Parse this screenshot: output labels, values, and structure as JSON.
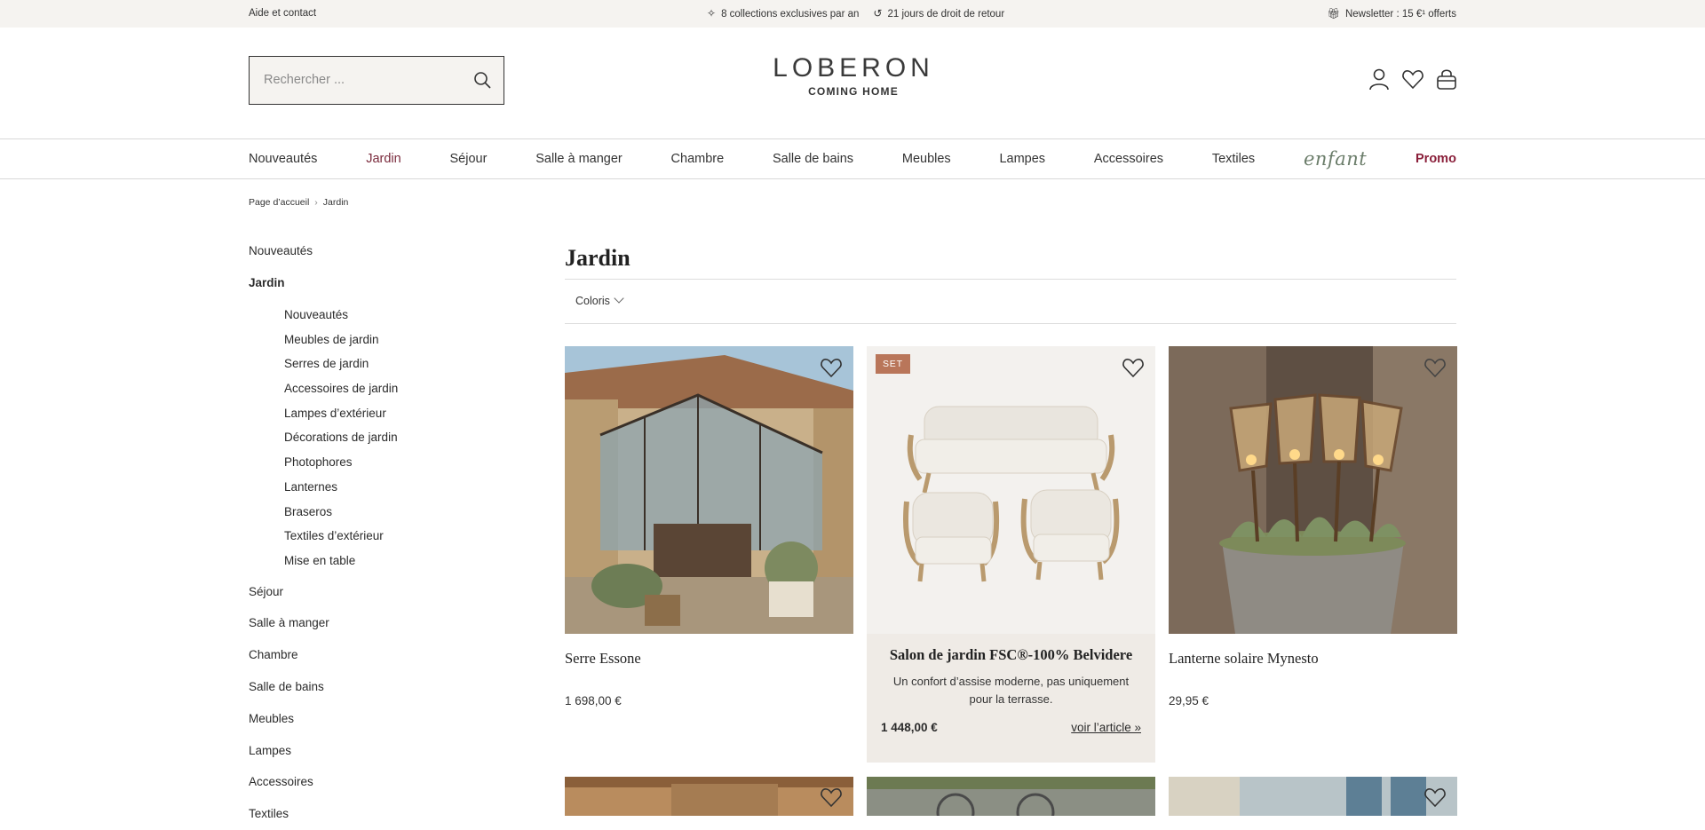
{
  "topbar": {
    "help": "Aide et contact",
    "usp1": "8 collections exclusives par an",
    "usp2": "21 jours de droit de retour",
    "newsletter": "Newsletter : 15 €¹ offerts"
  },
  "header": {
    "search_placeholder": "Rechercher ...",
    "logo_name": "LOBERON",
    "logo_tag": "COMING HOME"
  },
  "nav": {
    "items": [
      "Nouveautés",
      "Jardin",
      "Séjour",
      "Salle à manger",
      "Chambre",
      "Salle de bains",
      "Meubles",
      "Lampes",
      "Accessoires",
      "Textiles",
      "enfant",
      "Promo"
    ]
  },
  "breadcrumb": {
    "home": "Page d’accueil",
    "current": "Jardin"
  },
  "sidebar": {
    "top": "Nouveautés",
    "active": "Jardin",
    "sub": [
      "Nouveautés",
      "Meubles de jardin",
      "Serres de jardin",
      "Accessoires de jardin",
      "Lampes d’extérieur",
      "Décorations de jardin",
      "Photophores",
      "Lanternes",
      "Braseros",
      "Textiles d’extérieur",
      "Mise en table"
    ],
    "rest": [
      "Séjour",
      "Salle à manger",
      "Chambre",
      "Salle de bains",
      "Meubles",
      "Lampes",
      "Accessoires",
      "Textiles"
    ]
  },
  "main": {
    "title": "Jardin",
    "filter_label": "Coloris"
  },
  "products": [
    {
      "title": "Serre Essone",
      "price": "1 698,00 €"
    },
    {
      "badge": "SET",
      "title": "Salon de jardin FSC®-100% Belvidere",
      "desc": "Un confort d’assise moderne, pas uniquement pour la terrasse.",
      "price": "1 448,00 €",
      "link": "voir l’article »"
    },
    {
      "title": "Lanterne solaire Mynesto",
      "price": "29,95 €"
    }
  ]
}
